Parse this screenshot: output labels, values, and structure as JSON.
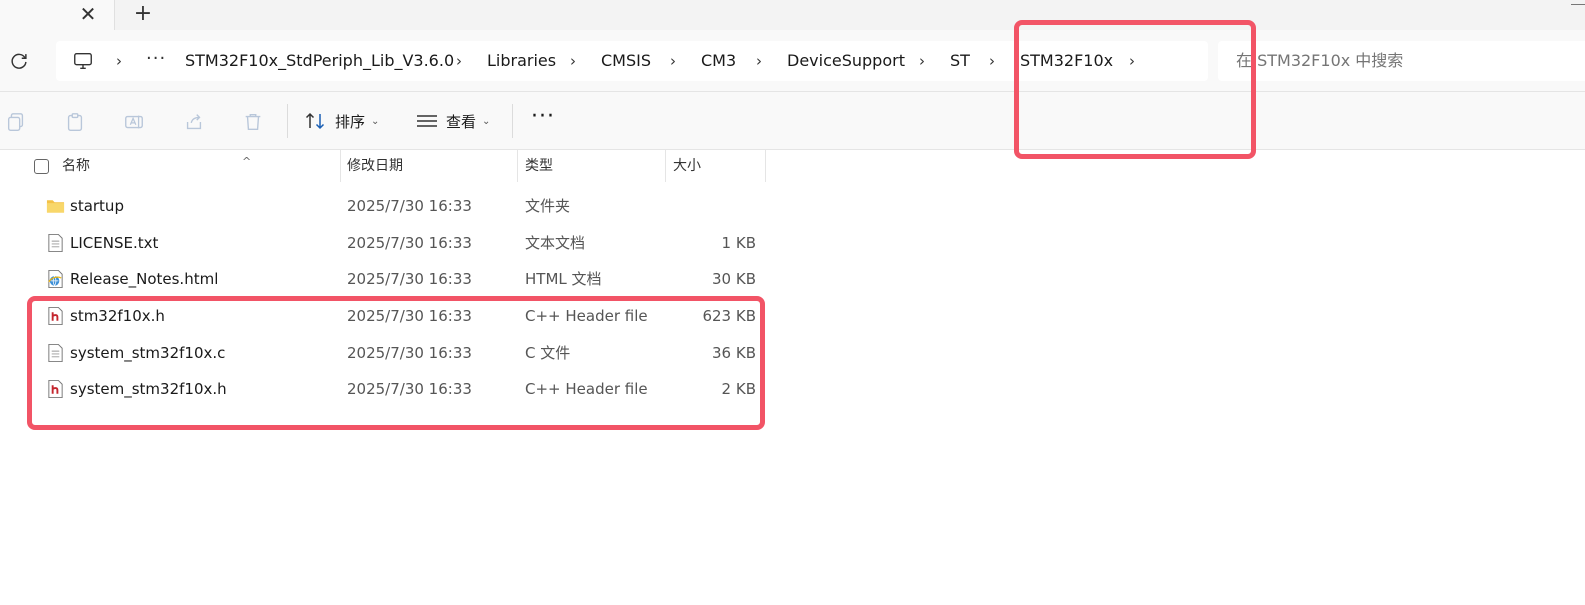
{
  "tabstrip": {
    "close_glyph": "✕",
    "new_tab_glyph": "+"
  },
  "address": {
    "more_glyph": "···",
    "separator": "›",
    "breadcrumbs": [
      "STM32F10x_StdPeriph_Lib_V3.6.0",
      "Libraries",
      "CMSIS",
      "CM3",
      "DeviceSupport",
      "ST",
      "STM32F10x"
    ],
    "search_placeholder": "在 STM32F10x 中搜索"
  },
  "commandbar": {
    "sort_label": "排序",
    "view_label": "查看",
    "more_glyph": "···",
    "chevron": "⌄"
  },
  "columns": {
    "name": "名称",
    "date": "修改日期",
    "type": "类型",
    "size": "大小",
    "sort_glyph": "^"
  },
  "files": [
    {
      "name": "startup",
      "date": "2025/7/30 16:33",
      "type": "文件夹",
      "size": "",
      "icon": "folder-icon"
    },
    {
      "name": "LICENSE.txt",
      "date": "2025/7/30 16:33",
      "type": "文本文档",
      "size": "1 KB",
      "icon": "text-file-icon"
    },
    {
      "name": "Release_Notes.html",
      "date": "2025/7/30 16:33",
      "type": "HTML 文档",
      "size": "30 KB",
      "icon": "html-file-icon"
    },
    {
      "name": "stm32f10x.h",
      "date": "2025/7/30 16:33",
      "type": "C++ Header file",
      "size": "623 KB",
      "icon": "header-file-icon"
    },
    {
      "name": "system_stm32f10x.c",
      "date": "2025/7/30 16:33",
      "type": "C 文件",
      "size": "36 KB",
      "icon": "c-file-icon"
    },
    {
      "name": "system_stm32f10x.h",
      "date": "2025/7/30 16:33",
      "type": "C++ Header file",
      "size": "2 KB",
      "icon": "header-file-icon"
    }
  ],
  "colors": {
    "highlight": "#f25466",
    "folder": "#f4c247",
    "header_icon": "#c4262e"
  }
}
